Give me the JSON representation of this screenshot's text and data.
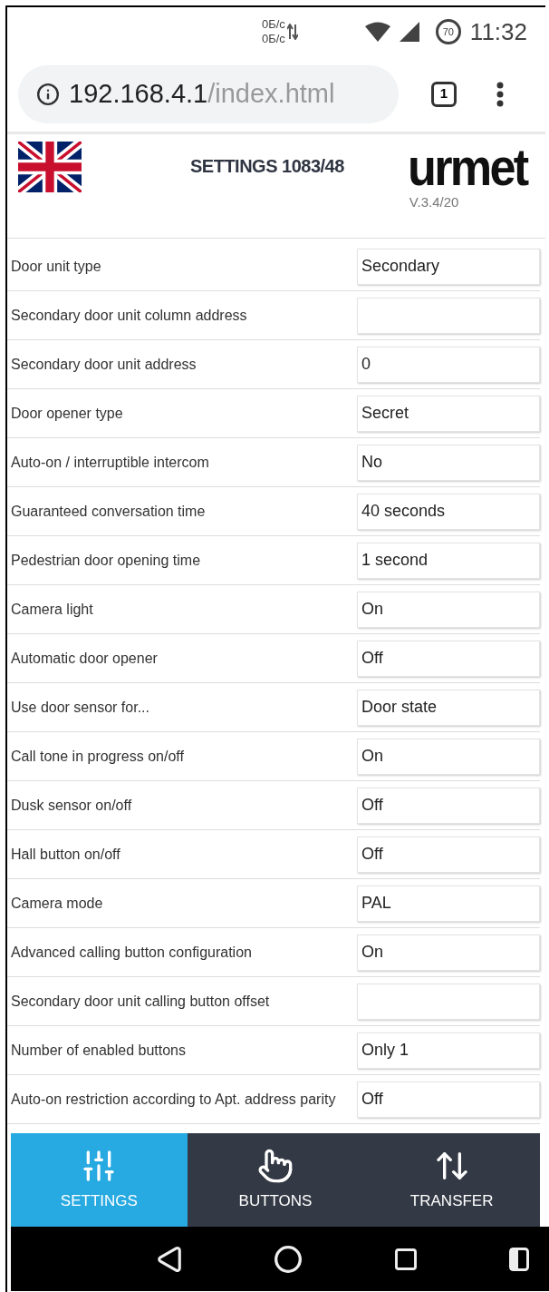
{
  "status_bar": {
    "speed_up": "0Б/с",
    "speed_down": "0Б/с",
    "data_saver": "70",
    "time": "11:32"
  },
  "browser": {
    "url_host": "192.168.4.1",
    "url_path": "/index.html",
    "tab_count": "1"
  },
  "header": {
    "title": "SETTINGS 1083/48",
    "logo": "urmet",
    "version": "V.3.4/20"
  },
  "settings": [
    {
      "label": "Door unit type",
      "value": "Secondary"
    },
    {
      "label": "Secondary door unit column address"
    },
    {
      "label": "Secondary door unit address",
      "value": "0"
    },
    {
      "label": "Door opener type",
      "value": "Secret"
    },
    {
      "label": "Auto-on / interruptible intercom",
      "value": "No"
    },
    {
      "label": "Guaranteed conversation time",
      "value": "40 seconds"
    },
    {
      "label": "Pedestrian door opening time",
      "value": "1 second"
    },
    {
      "label": "Camera light",
      "value": "On"
    },
    {
      "label": "Automatic door opener",
      "value": "Off"
    },
    {
      "label": "Use door sensor for...",
      "value": "Door state"
    },
    {
      "label": "Call tone in progress on/off",
      "value": "On"
    },
    {
      "label": "Dusk sensor on/off",
      "value": "Off"
    },
    {
      "label": "Hall button on/off",
      "value": "Off"
    },
    {
      "label": "Camera mode",
      "value": "PAL"
    },
    {
      "label": "Advanced calling button configuration",
      "value": "On"
    },
    {
      "label": "Secondary door unit calling button offset"
    },
    {
      "label": "Number of enabled buttons",
      "value": "Only 1"
    },
    {
      "label": "Auto-on restriction according to Apt. address parity",
      "value": "Off"
    }
  ],
  "tabs": [
    {
      "kind": "sliders",
      "label": "SETTINGS",
      "selected": true
    },
    {
      "kind": "pointer",
      "label": "BUTTONS",
      "selected": false
    },
    {
      "kind": "transfer",
      "label": "TRANSFER",
      "selected": false
    }
  ]
}
